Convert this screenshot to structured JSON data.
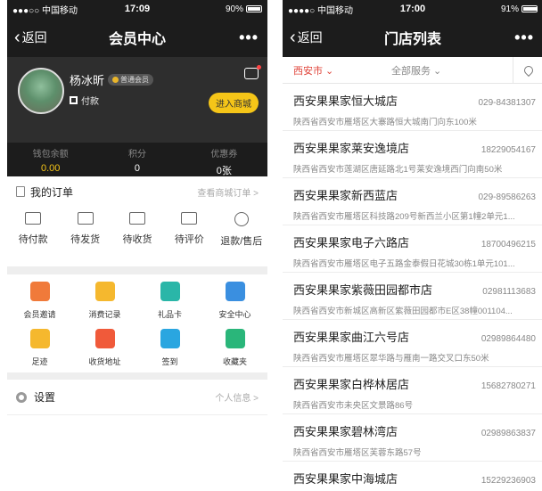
{
  "left": {
    "status": {
      "carrier": "●●●○○ 中国移动",
      "time": "17:09",
      "battery": "90%",
      "battery_level": 0.9
    },
    "nav": {
      "back": "返回",
      "title": "会员中心",
      "more": "•••"
    },
    "profile": {
      "name": "杨冰昕",
      "level": "普通会员",
      "pay": "付款",
      "shop_button": "进入商城"
    },
    "stats": [
      {
        "label": "钱包余额",
        "value": "0.00"
      },
      {
        "label": "积分",
        "value": "0"
      },
      {
        "label": "优惠券",
        "value": "0张"
      }
    ],
    "orders": {
      "title": "我的订单",
      "link": "查看商城订单 >",
      "items": [
        "待付款",
        "待发货",
        "待收货",
        "待评价",
        "退款/售后"
      ]
    },
    "services": [
      {
        "label": "会员邀请",
        "icon": "gift-mail-icon",
        "color": "#f07a3a"
      },
      {
        "label": "消费记录",
        "icon": "receipt-icon",
        "color": "#f5b82e"
      },
      {
        "label": "礼品卡",
        "icon": "gift-card-icon",
        "color": "#2ab6a8"
      },
      {
        "label": "安全中心",
        "icon": "shield-icon",
        "color": "#3a8fe0"
      },
      {
        "label": "足迹",
        "icon": "footprint-icon",
        "color": "#f5b82e"
      },
      {
        "label": "收货地址",
        "icon": "location-pin-icon",
        "color": "#f05a3a"
      },
      {
        "label": "签到",
        "icon": "calendar-icon",
        "color": "#2aa6e0"
      },
      {
        "label": "收藏夹",
        "icon": "favorites-tray-icon",
        "color": "#2ab67a"
      }
    ],
    "settings": {
      "label": "设置",
      "link": "个人信息 >"
    }
  },
  "right": {
    "status": {
      "carrier": "●●●●○ 中国移动",
      "time": "17:00",
      "battery": "91%",
      "battery_level": 0.91
    },
    "nav": {
      "back": "返回",
      "title": "门店列表",
      "more": "•••"
    },
    "filter": {
      "city": "西安市 ⌄",
      "service": "全部服务 ⌄"
    },
    "stores": [
      {
        "name": "西安果果家恒大城店",
        "tel": "029-84381307",
        "addr": "陕西省西安市雁塔区大寨路恒大城南门向东100米"
      },
      {
        "name": "西安果果家莱安逸境店",
        "tel": "18229054167",
        "addr": "陕西省西安市莲湖区唐延路北1号莱安逸境西门向南50米"
      },
      {
        "name": "西安果果家新西蓝店",
        "tel": "029-89586263",
        "addr": "陕西省西安市雁塔区科技路209号新西兰小区第1幢2单元1..."
      },
      {
        "name": "西安果果家电子六路店",
        "tel": "18700496215",
        "addr": "陕西省西安市雁塔区电子五路金泰假日花城30栋1单元101..."
      },
      {
        "name": "西安果果家紫薇田园都市店",
        "tel": "02981113683",
        "addr": "陕西省西安市新城区高新区紫薇田园都市E区38幢001104..."
      },
      {
        "name": "西安果果家曲江六号店",
        "tel": "02989864480",
        "addr": "陕西省西安市雁塔区翠华路与雁南一路交叉口东50米"
      },
      {
        "name": "西安果果家白桦林居店",
        "tel": "15682780271",
        "addr": "陕西省西安市未央区文景路86号"
      },
      {
        "name": "西安果果家碧林湾店",
        "tel": "02989863837",
        "addr": "陕西省西安市雁塔区芙蓉东路57号"
      },
      {
        "name": "西安果果家中海城店",
        "tel": "15229236903",
        "addr": ""
      }
    ]
  }
}
